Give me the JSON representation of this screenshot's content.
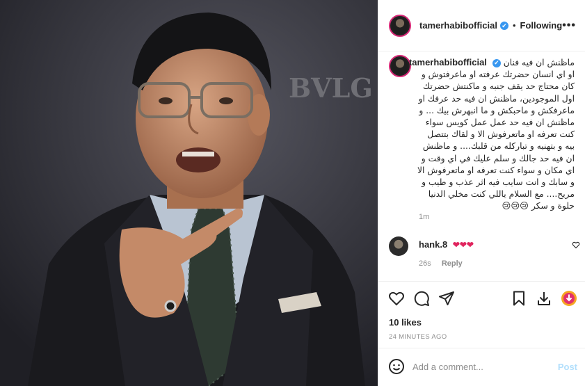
{
  "header": {
    "username": "tamerhabibofficial",
    "verified_mark": "✔",
    "separator": "•",
    "follow_label": "Following",
    "more_label": "•••"
  },
  "photo": {
    "backdrop_text": "BVLG",
    "alt": ""
  },
  "caption": {
    "username": "tamerhabibofficial",
    "lines": [
      "ماظنش ان فيه فنان",
      "او اي انسان حضرتك عرفته او ماعرفتوش و",
      "كان محتاج حد يقف جنبه و ماكنتش حضرتك",
      "اول الموجودين، ماظنش ان فيه حد عرفك او",
      "ماعرفكش و ماحبكش و ما انبهرش بيك ... و",
      "ماظنش ان فيه حد عمل عمل كويس سواء",
      "كنت تعرفه او ماتعرفوش الا و لقاك بتتصل",
      "بيه و بتهنيه و تباركله من قلبك.... و ماظنش",
      "ان فيه حد جالك و سلم عليك في اي وقت و",
      "اي مكان و سواء كنت تعرفه او ماتعرفوش الا",
      "و سابك و انت سايب فيه اثر عذب و طيب و",
      "مريح.... مع السلام ياللي كنت مخلي الدنيا",
      "حلوة و سكر 😢😢😢"
    ],
    "time": "1m"
  },
  "comment": {
    "username": "hank.8",
    "text": "❤❤❤",
    "time": "26s",
    "reply_label": "Reply"
  },
  "actions": {
    "likes": "10 likes",
    "ago": "24 MINUTES AGO"
  },
  "add_comment": {
    "placeholder": "Add a comment...",
    "post_label": "Post"
  },
  "colors": {
    "accent": "#3897f0",
    "heart": "#e0245e",
    "post_disabled": "#b2dffc",
    "muted": "#8e8e8e"
  }
}
